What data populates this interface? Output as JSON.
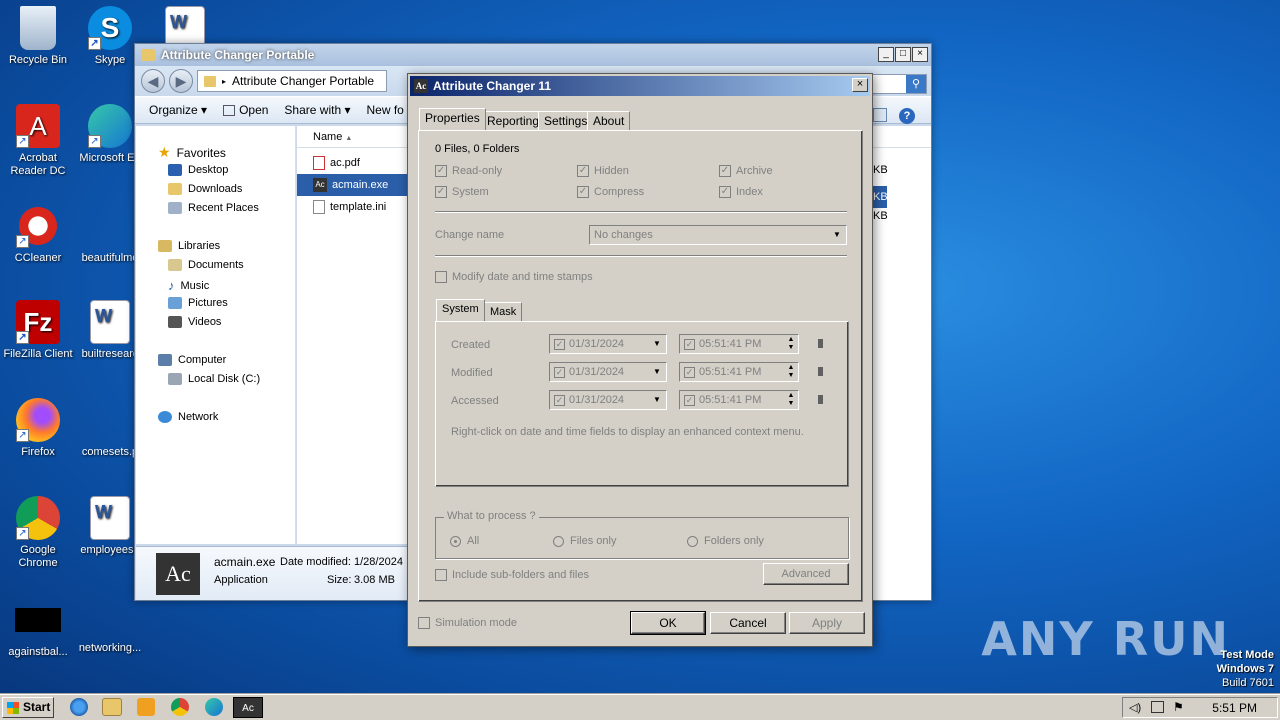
{
  "desktop": {
    "icons": [
      {
        "label": "Recycle Bin"
      },
      {
        "label": "Skype"
      },
      {
        "label": "Acrobat Reader DC"
      },
      {
        "label": "Microsoft Ed"
      },
      {
        "label": "CCleaner"
      },
      {
        "label": "beautifulmo"
      },
      {
        "label": "FileZilla Client"
      },
      {
        "label": "builtresearc"
      },
      {
        "label": "Firefox"
      },
      {
        "label": "comesets.p"
      },
      {
        "label": "Google Chrome"
      },
      {
        "label": "employeese"
      },
      {
        "label": "againstbal..."
      },
      {
        "label": "networking..."
      }
    ]
  },
  "explorer": {
    "title": "Attribute Changer Portable",
    "address": "Attribute Changer Portable",
    "toolbar": {
      "organize": "Organize",
      "open": "Open",
      "share_with": "Share with",
      "new_folder": "New fo"
    },
    "nav": {
      "favorites": "Favorites",
      "desktop": "Desktop",
      "downloads": "Downloads",
      "recent_places": "Recent Places",
      "libraries": "Libraries",
      "documents": "Documents",
      "music": "Music",
      "pictures": "Pictures",
      "videos": "Videos",
      "computer": "Computer",
      "local_disk": "Local Disk (C:)",
      "network": "Network"
    },
    "column_name": "Name",
    "files": [
      "ac.pdf",
      "acmain.exe",
      "template.ini"
    ],
    "size_fragments": [
      "KB",
      "KB",
      "KB"
    ],
    "details": {
      "filename": "acmain.exe",
      "date_modified_label": "Date modified:",
      "date_modified": "1/28/2024",
      "type": "Application",
      "size_label": "Size:",
      "size": "3.08 MB",
      "thumb_text": "Ac"
    }
  },
  "dialog": {
    "title": "Attribute Changer 11",
    "logo": "Ac",
    "tabs": [
      "Properties",
      "Reporting",
      "Settings",
      "About"
    ],
    "summary": "0 Files, 0 Folders",
    "attributes": [
      "Read-only",
      "Hidden",
      "Archive",
      "System",
      "Compress",
      "Index"
    ],
    "change_name_label": "Change name",
    "change_name_value": "No changes",
    "modify_stamps_label": "Modify date and time stamps",
    "subtabs": [
      "System",
      "Mask"
    ],
    "stamps": [
      {
        "label": "Created",
        "date": "01/31/2024",
        "time": "05:51:41  PM"
      },
      {
        "label": "Modified",
        "date": "01/31/2024",
        "time": "05:51:41  PM"
      },
      {
        "label": "Accessed",
        "date": "01/31/2024",
        "time": "05:51:41  PM"
      }
    ],
    "hint": "Right-click on date and time fields to display an enhanced context menu.",
    "what_to_process": "What to process ?",
    "process_options": [
      "All",
      "Files only",
      "Folders only"
    ],
    "include_subfolders": "Include sub-folders and files",
    "advanced": "Advanced",
    "simulation_mode": "Simulation mode",
    "ok": "OK",
    "cancel": "Cancel",
    "apply": "Apply"
  },
  "taskbar": {
    "start": "Start",
    "time": "5:51 PM"
  },
  "watermark": {
    "text": "ANY RUN",
    "test_mode": "Test Mode",
    "os": "Windows 7",
    "build": "Build 7601"
  }
}
